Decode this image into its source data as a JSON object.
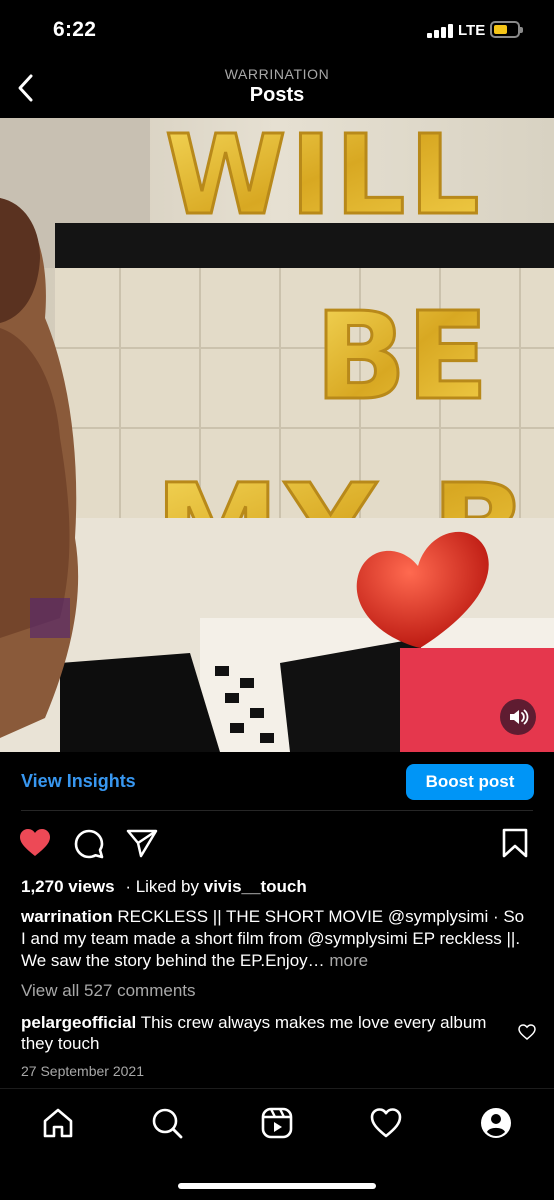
{
  "status_bar": {
    "time": "6:22",
    "network": "LTE",
    "battery_color": "#f5c518"
  },
  "header": {
    "account": "WARRINATION",
    "title": "Posts"
  },
  "media": {
    "balloon_text": [
      "WILL",
      "BE",
      "MY B"
    ]
  },
  "insights": {
    "view_insights_label": "View Insights",
    "boost_label": "Boost post"
  },
  "post": {
    "views": "1,270 views",
    "liked_by_prefix": "· Liked by",
    "liked_by_user": "vivis__touch",
    "caption_user": "warrination",
    "caption_text": "RECKLESS || THE SHORT MOVIE @symplysimi · So I and my team made a short film from @symplysimi EP reckless ||. We saw the story behind the EP.Enjoy…",
    "more_label": "more",
    "view_all_comments": "View all 527 comments",
    "comment_user": "pelargeofficial",
    "comment_text": "This crew always makes me love every album they touch",
    "date": "27 September 2021"
  },
  "colors": {
    "like_red": "#ed4956",
    "link_blue": "#3897f0",
    "boost_blue": "#0095f6"
  },
  "icons": [
    "back-arrow-icon",
    "heart-icon",
    "comment-icon",
    "share-icon",
    "bookmark-icon",
    "volume-icon",
    "home-icon",
    "search-icon",
    "reels-icon",
    "activity-heart-icon",
    "profile-icon"
  ]
}
